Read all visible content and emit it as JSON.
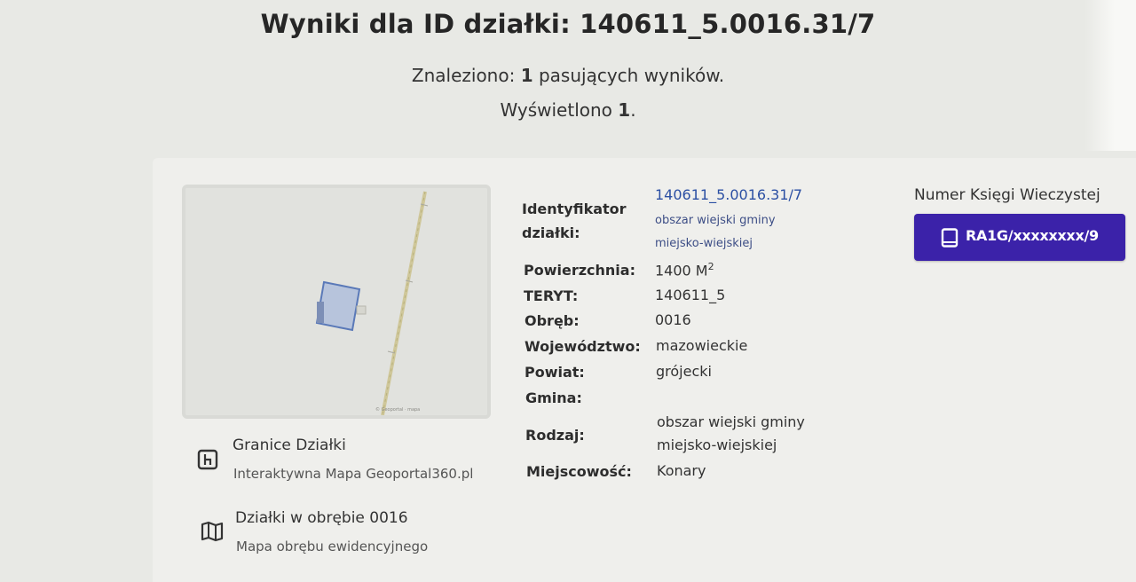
{
  "header": {
    "title": "Wyniki dla ID działki: 140611_5.0016.31/7",
    "found_prefix": "Znaleziono: ",
    "found_count": "1",
    "found_suffix": " pasujących wyników.",
    "shown_prefix": "Wyświetlono ",
    "shown_count": "1",
    "shown_suffix": "."
  },
  "links": {
    "boundaries": {
      "title": "Granice Działki",
      "subtitle": "Interaktywna Mapa Geoportal360.pl",
      "icon": "map-pin-square-icon"
    },
    "precinct": {
      "title": "Działki w obrębie 0016",
      "subtitle": "Mapa obrębu ewidencyjnego",
      "icon": "folded-map-icon"
    }
  },
  "details": {
    "identifier": {
      "label_line1": "Identyfikator",
      "label_line2": "działki:",
      "value": "140611_5.0016.31/7",
      "sub_line1": "obszar wiejski gminy",
      "sub_line2": "miejsko-wiejskiej"
    },
    "area": {
      "label": "Powierzchnia:",
      "value": "1400 M",
      "unit_sup": "2"
    },
    "teryt": {
      "label": "TERYT:",
      "value": "140611_5"
    },
    "obreb": {
      "label": "Obręb:",
      "value": "0016"
    },
    "voivodeship": {
      "label": "Województwo:",
      "value": "mazowieckie"
    },
    "county": {
      "label": "Powiat:",
      "value": "grójecki"
    },
    "commune": {
      "label": "Gmina:",
      "value": ""
    },
    "type": {
      "label": "Rodzaj:",
      "value_line1": "obszar wiejski gminy",
      "value_line2": "miejsko-wiejskiej"
    },
    "locality": {
      "label": "Miejscowość:",
      "value": "Konary"
    }
  },
  "land_registry": {
    "label": "Numer Księgi Wieczystej",
    "button_text": "RA1G/xxxxxxxx/9",
    "button_icon": "book-icon",
    "accent_color": "#3b22a9"
  }
}
